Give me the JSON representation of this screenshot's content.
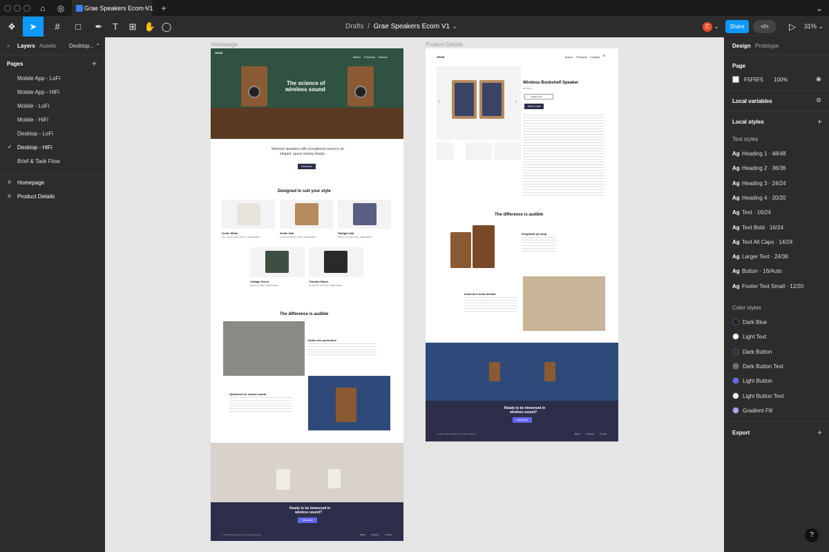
{
  "tabbar": {
    "file_tab": "Grae Speakers Ecom V1"
  },
  "toolbar": {
    "breadcrumb_drafts": "Drafts",
    "breadcrumb_sep": "/",
    "breadcrumb_file": "Grae Speakers Ecom V1",
    "avatar_letter": "C",
    "share_label": "Share",
    "zoom": "31%"
  },
  "left_panel": {
    "tabs": [
      "Layers",
      "Assets"
    ],
    "page_switch": "Desktop...",
    "pages_header": "Pages",
    "pages": [
      "Mobile App - LoFi",
      "Mobile App - HiFi",
      "Mobile - LoFi",
      "Mobile - HiFi",
      "Desktop - LoFi",
      "Desktop - HiFi",
      "Brief & Task Flow"
    ],
    "current_page_index": 5,
    "frames": [
      "Homepage",
      "Product Details"
    ]
  },
  "right_panel": {
    "tabs": [
      "Design",
      "Prototype"
    ],
    "page_section": "Page",
    "page_color": "F5F5F5",
    "page_opacity": "100%",
    "local_variables": "Local variables",
    "local_styles": "Local styles",
    "text_styles_header": "Text styles",
    "text_styles": [
      {
        "ag": "Ag",
        "name": "Heading 1 · 48/48"
      },
      {
        "ag": "Ag",
        "name": "Heading 2 · 36/36"
      },
      {
        "ag": "Ag",
        "name": "Heading 3 · 24/24"
      },
      {
        "ag": "Ag",
        "name": "Heading 4 · 20/20"
      },
      {
        "ag": "Ag",
        "name": "Text · 16/24"
      },
      {
        "ag": "Ag",
        "name": "Text Bold · 16/24"
      },
      {
        "ag": "Ag",
        "name": "Text All Caps · 14/24"
      },
      {
        "ag": "Ag",
        "name": "Larger Text · 24/36"
      },
      {
        "ag": "Ag",
        "name": "Button · 16/Auto"
      },
      {
        "ag": "Ag",
        "name": "Footer Text Small · 12/20"
      }
    ],
    "color_styles_header": "Color styles",
    "color_styles": [
      {
        "name": "Dark Blue",
        "color": "#1f2238"
      },
      {
        "name": "Light Text",
        "color": "#ffffff"
      },
      {
        "name": "Dark Button",
        "color": "#2c2e4a"
      },
      {
        "name": "Dark Button Text",
        "color": "#6b6d80"
      },
      {
        "name": "Light Button",
        "color": "#6366f1"
      },
      {
        "name": "Light Button Text",
        "color": "#f0f0f5"
      },
      {
        "name": "Gradient Fill",
        "color": "#a5a8f5"
      }
    ],
    "export": "Export"
  },
  "canvas": {
    "homepage": {
      "label": "Homepage",
      "logo": "GRAE",
      "nav": [
        "Brand",
        "Products",
        "Contact"
      ],
      "hero_title_1": "The science of",
      "hero_title_2": "wireless sound",
      "intro_1": "Wireless speakers with exceptional sound in an",
      "intro_2": "elegant, space-saving design.",
      "discover": "Discover",
      "section_title": "Designed to suit your style",
      "products": [
        {
          "name": "Arctic White",
          "desc": "For a soothing atmosphere.",
          "link": "Learn more..."
        },
        {
          "name": "Arctic Oak",
          "desc": "A soft and timeless finish.",
          "link": "Learn more..."
        },
        {
          "name": "Twilight Oak",
          "desc": "Vibrant, and refreshing.",
          "link": "Learn more..."
        },
        {
          "name": "Vintage Green",
          "desc": "Bold and classic.",
          "link": "Learn more..."
        },
        {
          "name": "Thunder Black",
          "desc": "An elegant must-have.",
          "link": "Learn more..."
        }
      ],
      "diff_title": "The difference is audible",
      "feature1_title": "Clutter-free perfection",
      "feature2_title": "Optimized for classic sound",
      "cta_1": "Ready to be immersed in",
      "cta_2": "wireless sound?",
      "cta_button": "Discover",
      "footer_copy": "© 2023 Grae Speakers. All rights reserved.",
      "footer_nav": [
        "Brand",
        "Products",
        "Contact"
      ]
    },
    "product": {
      "label": "Product Details",
      "logo": "GRAE",
      "nav": [
        "Brand",
        "Products",
        "Contact"
      ],
      "title": "Wireless Bookshelf Speaker",
      "price": "DE 299 $",
      "select": "Twilight Oak",
      "add_to_cart": "Add to cart",
      "diff_title": "The difference is audible",
      "feature1_title": "Integrated pre-amp",
      "feature2_title": "Immersive home theater",
      "cta_1": "Ready to be immersed in",
      "cta_2": "wireless sound?",
      "cta_button": "Discover",
      "footer_copy": "© 2023 Grae Speakers. All rights reserved.",
      "footer_nav": [
        "Brand",
        "Products",
        "Contact"
      ]
    }
  },
  "help": "?"
}
